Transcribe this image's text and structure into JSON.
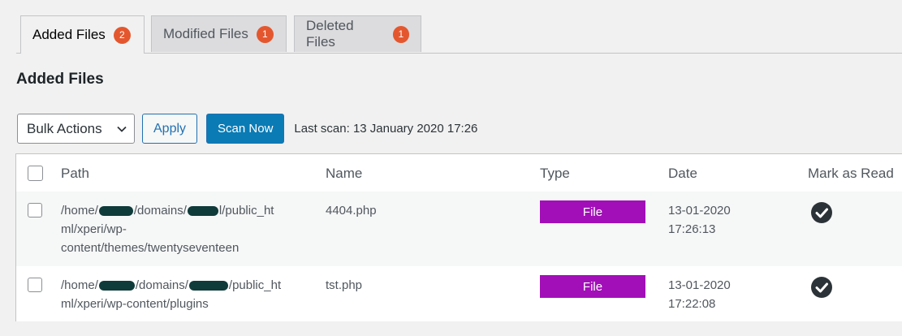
{
  "tabs": [
    {
      "label": "Added Files",
      "count": "2"
    },
    {
      "label": "Modified Files",
      "count": "1"
    },
    {
      "label": "Deleted Files",
      "count": "1"
    }
  ],
  "heading": "Added Files",
  "toolbar": {
    "bulk_actions": "Bulk Actions",
    "apply_label": "Apply",
    "scan_label": "Scan Now",
    "last_scan": "Last scan: 13 January 2020 17:26"
  },
  "table": {
    "columns": [
      "Path",
      "Name",
      "Type",
      "Date",
      "Mark as Read"
    ],
    "rows": [
      {
        "path_line1_a": "/home/",
        "path_line1_b": "/domains/",
        "path_line1_c": "l/public_ht",
        "path_line2": "ml/xperi/wp-",
        "path_line3": "content/themes/twentyseventeen",
        "name": "4404.php",
        "type": "File",
        "date": "13-01-2020",
        "time": "17:26:13"
      },
      {
        "path_line1_a": "/home/",
        "path_line1_b": "/domains/",
        "path_line1_c": "/public_ht",
        "path_line2": "ml/xperi/wp-content/plugins",
        "name": "tst.php",
        "type": "File",
        "date": "13-01-2020",
        "time": "17:22:08"
      }
    ]
  },
  "colors": {
    "badge": "#e4572e",
    "type_badge": "#a20fb8",
    "primary_button": "#0a7bb5",
    "redaction": "#0f3b3a"
  },
  "icons": {
    "select_arrow": "chevron-down-icon",
    "mark_read": "check-circle-icon"
  }
}
